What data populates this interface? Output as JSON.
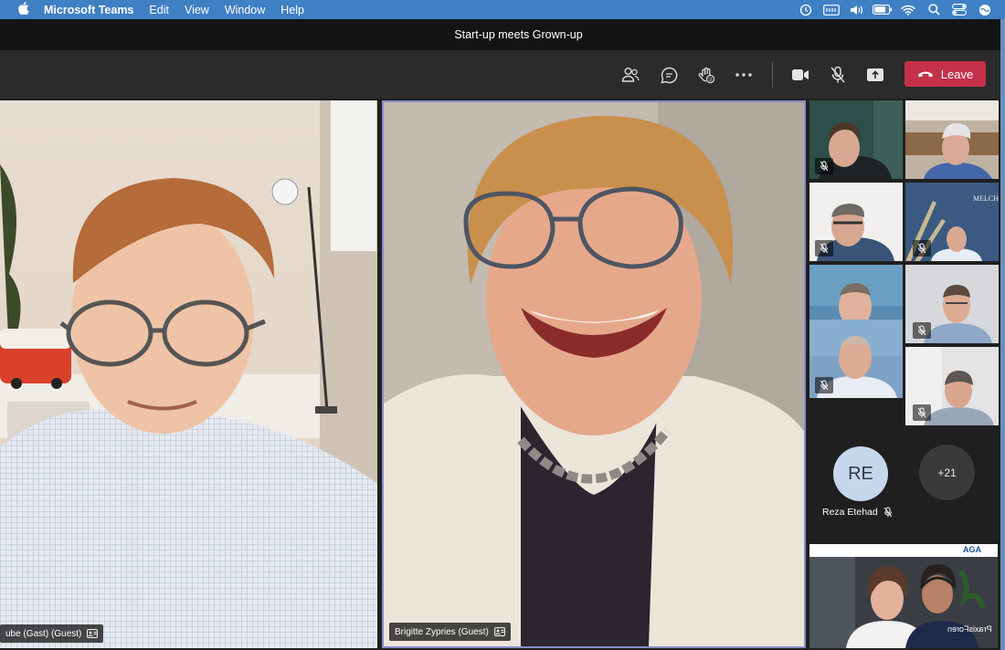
{
  "menubar": {
    "app_name": "Microsoft Teams",
    "items": [
      "Edit",
      "View",
      "Window",
      "Help"
    ],
    "status_icons": [
      "time-machine-icon",
      "keyboard-input-icon",
      "volume-icon",
      "battery-icon",
      "wifi-icon",
      "spotlight-search-icon",
      "control-center-icon",
      "siri-icon"
    ]
  },
  "window": {
    "title": "Start-up meets Grown-up"
  },
  "toolbar": {
    "people_icon": "people-icon",
    "chat_icon": "chat-icon",
    "reactions_icon": "reactions-icon",
    "more_icon": "more-actions-icon",
    "camera_icon": "camera-icon",
    "mic_icon": "mic-muted-icon",
    "share_icon": "share-screen-icon",
    "leave_label": "Leave"
  },
  "participants": {
    "left": {
      "name": "ube (Gast) (Guest)"
    },
    "center": {
      "name": "Brigitte Zypries (Guest)"
    },
    "reza": {
      "initials": "RE",
      "name": "Reza Etehad"
    },
    "overflow": {
      "label": "+21"
    },
    "bottom": {
      "logo": "AGA",
      "caption": "PraxisForen"
    },
    "tile_logo": "MELCHE"
  },
  "colors": {
    "leave": "#c4314b",
    "active_speaker_border": "#8b8cc7",
    "menubar": "#3f7fc4"
  }
}
